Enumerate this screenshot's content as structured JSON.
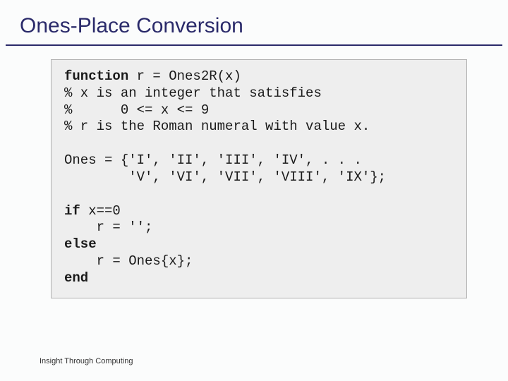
{
  "title": "Ones-Place Conversion",
  "code": {
    "kw_function": "function",
    "sig_rest": " r = Ones2R(x)",
    "c1": "% x is an integer that satisfies",
    "c2": "%      0 <= x <= 9",
    "c3": "% r is the Roman numeral with value x.",
    "arr1": "Ones = {'I', 'II', 'III', 'IV', . . .",
    "arr2": "        'V', 'VI', 'VII', 'VIII', 'IX'};",
    "kw_if": "if",
    "if_rest": " x==0",
    "then_line": "    r = '';",
    "kw_else": "else",
    "else_line": "    r = Ones{x};",
    "kw_end": "end"
  },
  "footer": "Insight Through Computing"
}
